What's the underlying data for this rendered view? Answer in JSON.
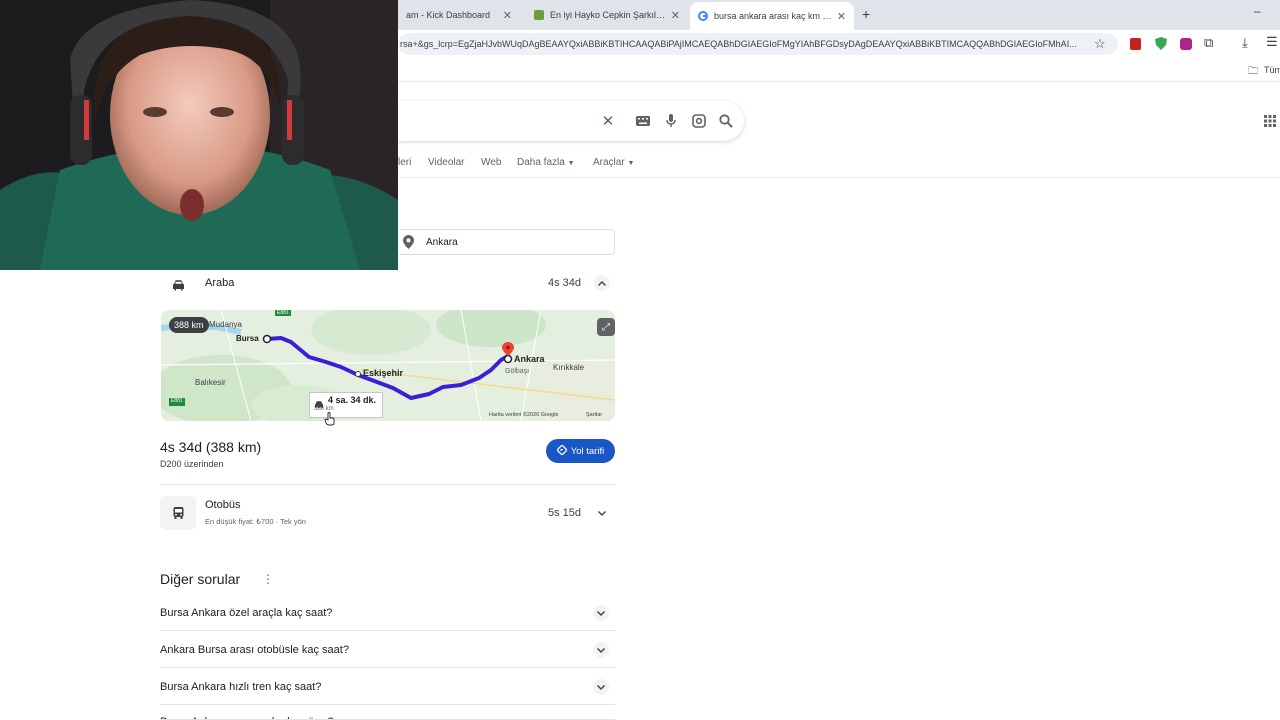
{
  "browser": {
    "tabs": [
      {
        "title": "am - Kick Dashboard"
      },
      {
        "title": "En iyi Hayko Cepkin Şarkıları - T"
      },
      {
        "title": "bursa ankara arası kaç km - Go"
      }
    ],
    "new_tab": "+",
    "url": "rsa+&gs_lcrp=EgZjaHJvbWUqDAgBEAAYQxiABBiKBTIHCAAQABiPAjIMCAEQABhDGIAEGIoFMgYIAhBFGDsyDAgDEAAYQxiABBiKBTIMCAQQABhDGIAEGIoFMhAI...",
    "bookmarks_all": "Tüm"
  },
  "search": {
    "nav_tabs": [
      "leri",
      "Videolar",
      "Web",
      "Daha fazla",
      "Araçlar"
    ]
  },
  "route": {
    "destination": "Ankara",
    "car": {
      "mode": "Araba",
      "duration": "4s 34d"
    },
    "map": {
      "distance_badge": "388 km",
      "places": [
        "Mudanya",
        "Bursa",
        "Ankara",
        "Eskişehir",
        "Balıkesir",
        "Kırıkkale",
        "Gölbaşı"
      ],
      "callout_time": "4 sa. 34 dk.",
      "callout_dist": "388 km",
      "footer_data": "Harita verileri ©2026 Google",
      "footer_terms": "Şartlar",
      "road_labels": [
        "E881",
        "E881"
      ]
    },
    "summary": "4s 34d (388 km)",
    "via": "D200 üzerinden",
    "directions_button": "Yol tarifi",
    "bus": {
      "mode": "Otobüs",
      "price": "En düşük fiyat: ₺700 · Tek yön",
      "duration": "5s 15d"
    }
  },
  "other_questions": {
    "title": "Diğer sorular",
    "items": [
      "Bursa Ankara özel araçla kaç saat?",
      "Ankara Bursa arası otobüsle kaç saat?",
      "Bursa Ankara hızlı tren kaç saat?",
      "Bursa Ankara arası ne kadar sürer?"
    ]
  },
  "colors": {
    "route": "#3b1fd6",
    "accent": "#1a57c6",
    "pin": "#ea4335"
  }
}
